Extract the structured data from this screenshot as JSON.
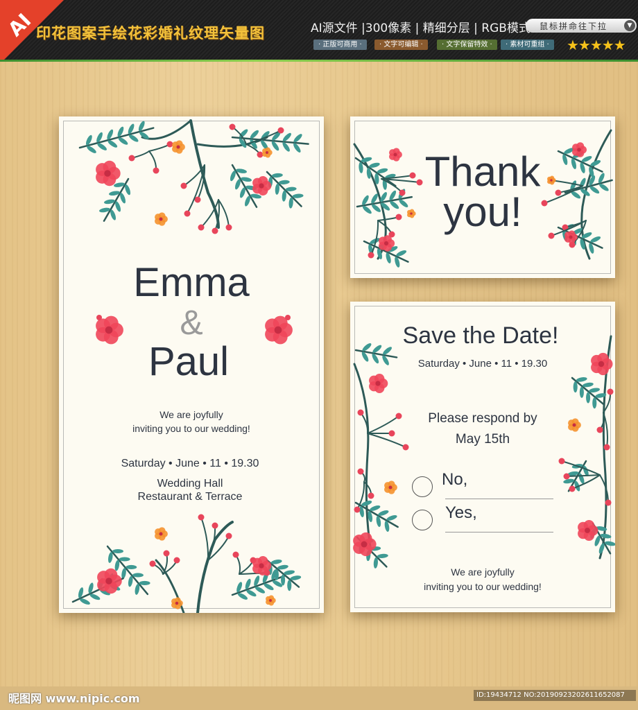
{
  "banner": {
    "ai_badge": "AI",
    "title": "印花图案手绘花彩婚礼纹理矢量图",
    "specs": "AI源文件 |300像素 | 精细分层 | RGB模式",
    "tags": [
      "· 正版可商用 ·",
      "· 文字可编辑 ·",
      "· 文字保留特效 ·",
      "· 素材可重组 ·"
    ],
    "scroll_hint": "鼠标拼命往下拉",
    "rating_stars": "★★★★★",
    "rating": 5
  },
  "wedding_card": {
    "name1": "Emma",
    "ampersand": "&",
    "name2": "Paul",
    "invite_line1": "We are joyfully",
    "invite_line2": "inviting you to our wedding!",
    "date": "Saturday • June • 11 • 19.30",
    "venue_line1": "Wedding Hall",
    "venue_line2": "Restaurant & Terrace"
  },
  "thank_card": {
    "line1": "Thank",
    "line2": "you!"
  },
  "rsvp_card": {
    "title": "Save the Date!",
    "date": "Saturday • June • 11 • 19.30",
    "respond_line1": "Please respond by",
    "respond_line2": "May 15th",
    "option_no": "No,",
    "option_yes": "Yes,",
    "invite_line1": "We are joyfully",
    "invite_line2": "inviting you to our wedding!"
  },
  "colors": {
    "leaf": "#3f9a93",
    "stem": "#2d5a57",
    "berry": "#e8455b",
    "flower": "#f0465a",
    "orange": "#f5922f",
    "ink": "#2d3441"
  },
  "footer": {
    "watermark_logo": "昵图网 www.nipic.com",
    "image_id": "ID:19434712 NO:20190923202611652087"
  }
}
